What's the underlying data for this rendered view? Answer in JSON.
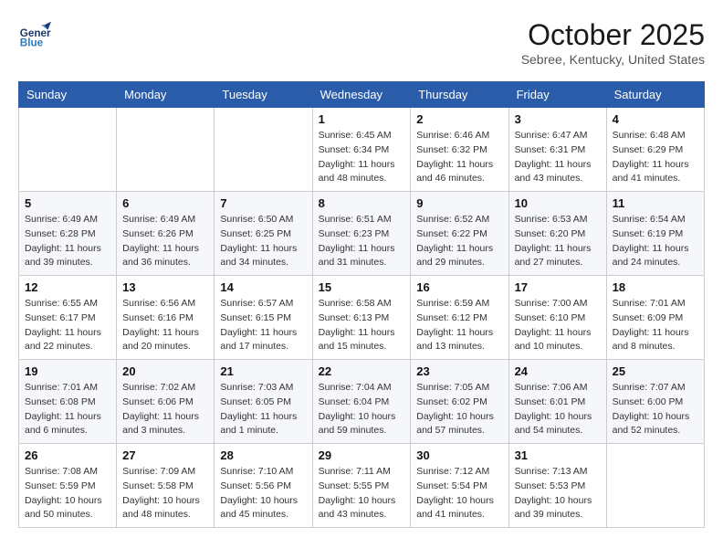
{
  "header": {
    "logo_line1": "General",
    "logo_line2": "Blue",
    "month": "October 2025",
    "location": "Sebree, Kentucky, United States"
  },
  "weekdays": [
    "Sunday",
    "Monday",
    "Tuesday",
    "Wednesday",
    "Thursday",
    "Friday",
    "Saturday"
  ],
  "weeks": [
    [
      {
        "day": "",
        "sunrise": "",
        "sunset": "",
        "daylight": ""
      },
      {
        "day": "",
        "sunrise": "",
        "sunset": "",
        "daylight": ""
      },
      {
        "day": "",
        "sunrise": "",
        "sunset": "",
        "daylight": ""
      },
      {
        "day": "1",
        "sunrise": "Sunrise: 6:45 AM",
        "sunset": "Sunset: 6:34 PM",
        "daylight": "Daylight: 11 hours and 48 minutes."
      },
      {
        "day": "2",
        "sunrise": "Sunrise: 6:46 AM",
        "sunset": "Sunset: 6:32 PM",
        "daylight": "Daylight: 11 hours and 46 minutes."
      },
      {
        "day": "3",
        "sunrise": "Sunrise: 6:47 AM",
        "sunset": "Sunset: 6:31 PM",
        "daylight": "Daylight: 11 hours and 43 minutes."
      },
      {
        "day": "4",
        "sunrise": "Sunrise: 6:48 AM",
        "sunset": "Sunset: 6:29 PM",
        "daylight": "Daylight: 11 hours and 41 minutes."
      }
    ],
    [
      {
        "day": "5",
        "sunrise": "Sunrise: 6:49 AM",
        "sunset": "Sunset: 6:28 PM",
        "daylight": "Daylight: 11 hours and 39 minutes."
      },
      {
        "day": "6",
        "sunrise": "Sunrise: 6:49 AM",
        "sunset": "Sunset: 6:26 PM",
        "daylight": "Daylight: 11 hours and 36 minutes."
      },
      {
        "day": "7",
        "sunrise": "Sunrise: 6:50 AM",
        "sunset": "Sunset: 6:25 PM",
        "daylight": "Daylight: 11 hours and 34 minutes."
      },
      {
        "day": "8",
        "sunrise": "Sunrise: 6:51 AM",
        "sunset": "Sunset: 6:23 PM",
        "daylight": "Daylight: 11 hours and 31 minutes."
      },
      {
        "day": "9",
        "sunrise": "Sunrise: 6:52 AM",
        "sunset": "Sunset: 6:22 PM",
        "daylight": "Daylight: 11 hours and 29 minutes."
      },
      {
        "day": "10",
        "sunrise": "Sunrise: 6:53 AM",
        "sunset": "Sunset: 6:20 PM",
        "daylight": "Daylight: 11 hours and 27 minutes."
      },
      {
        "day": "11",
        "sunrise": "Sunrise: 6:54 AM",
        "sunset": "Sunset: 6:19 PM",
        "daylight": "Daylight: 11 hours and 24 minutes."
      }
    ],
    [
      {
        "day": "12",
        "sunrise": "Sunrise: 6:55 AM",
        "sunset": "Sunset: 6:17 PM",
        "daylight": "Daylight: 11 hours and 22 minutes."
      },
      {
        "day": "13",
        "sunrise": "Sunrise: 6:56 AM",
        "sunset": "Sunset: 6:16 PM",
        "daylight": "Daylight: 11 hours and 20 minutes."
      },
      {
        "day": "14",
        "sunrise": "Sunrise: 6:57 AM",
        "sunset": "Sunset: 6:15 PM",
        "daylight": "Daylight: 11 hours and 17 minutes."
      },
      {
        "day": "15",
        "sunrise": "Sunrise: 6:58 AM",
        "sunset": "Sunset: 6:13 PM",
        "daylight": "Daylight: 11 hours and 15 minutes."
      },
      {
        "day": "16",
        "sunrise": "Sunrise: 6:59 AM",
        "sunset": "Sunset: 6:12 PM",
        "daylight": "Daylight: 11 hours and 13 minutes."
      },
      {
        "day": "17",
        "sunrise": "Sunrise: 7:00 AM",
        "sunset": "Sunset: 6:10 PM",
        "daylight": "Daylight: 11 hours and 10 minutes."
      },
      {
        "day": "18",
        "sunrise": "Sunrise: 7:01 AM",
        "sunset": "Sunset: 6:09 PM",
        "daylight": "Daylight: 11 hours and 8 minutes."
      }
    ],
    [
      {
        "day": "19",
        "sunrise": "Sunrise: 7:01 AM",
        "sunset": "Sunset: 6:08 PM",
        "daylight": "Daylight: 11 hours and 6 minutes."
      },
      {
        "day": "20",
        "sunrise": "Sunrise: 7:02 AM",
        "sunset": "Sunset: 6:06 PM",
        "daylight": "Daylight: 11 hours and 3 minutes."
      },
      {
        "day": "21",
        "sunrise": "Sunrise: 7:03 AM",
        "sunset": "Sunset: 6:05 PM",
        "daylight": "Daylight: 11 hours and 1 minute."
      },
      {
        "day": "22",
        "sunrise": "Sunrise: 7:04 AM",
        "sunset": "Sunset: 6:04 PM",
        "daylight": "Daylight: 10 hours and 59 minutes."
      },
      {
        "day": "23",
        "sunrise": "Sunrise: 7:05 AM",
        "sunset": "Sunset: 6:02 PM",
        "daylight": "Daylight: 10 hours and 57 minutes."
      },
      {
        "day": "24",
        "sunrise": "Sunrise: 7:06 AM",
        "sunset": "Sunset: 6:01 PM",
        "daylight": "Daylight: 10 hours and 54 minutes."
      },
      {
        "day": "25",
        "sunrise": "Sunrise: 7:07 AM",
        "sunset": "Sunset: 6:00 PM",
        "daylight": "Daylight: 10 hours and 52 minutes."
      }
    ],
    [
      {
        "day": "26",
        "sunrise": "Sunrise: 7:08 AM",
        "sunset": "Sunset: 5:59 PM",
        "daylight": "Daylight: 10 hours and 50 minutes."
      },
      {
        "day": "27",
        "sunrise": "Sunrise: 7:09 AM",
        "sunset": "Sunset: 5:58 PM",
        "daylight": "Daylight: 10 hours and 48 minutes."
      },
      {
        "day": "28",
        "sunrise": "Sunrise: 7:10 AM",
        "sunset": "Sunset: 5:56 PM",
        "daylight": "Daylight: 10 hours and 45 minutes."
      },
      {
        "day": "29",
        "sunrise": "Sunrise: 7:11 AM",
        "sunset": "Sunset: 5:55 PM",
        "daylight": "Daylight: 10 hours and 43 minutes."
      },
      {
        "day": "30",
        "sunrise": "Sunrise: 7:12 AM",
        "sunset": "Sunset: 5:54 PM",
        "daylight": "Daylight: 10 hours and 41 minutes."
      },
      {
        "day": "31",
        "sunrise": "Sunrise: 7:13 AM",
        "sunset": "Sunset: 5:53 PM",
        "daylight": "Daylight: 10 hours and 39 minutes."
      },
      {
        "day": "",
        "sunrise": "",
        "sunset": "",
        "daylight": ""
      }
    ]
  ]
}
